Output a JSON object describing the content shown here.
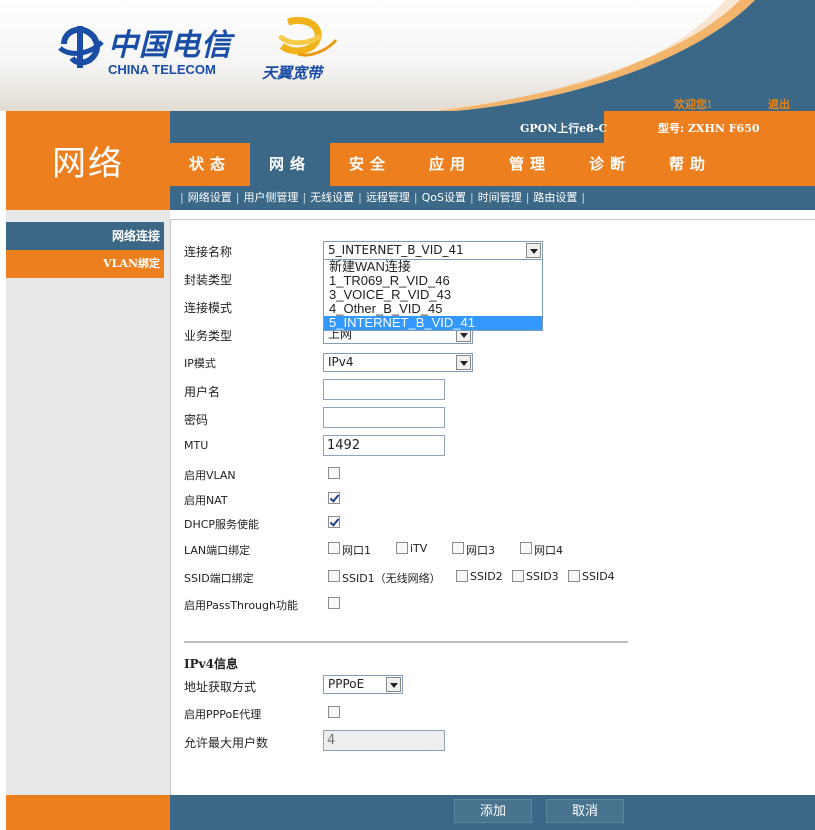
{
  "header": {
    "brand_cn": "中国电信",
    "brand_en": "CHINA TELECOM",
    "product_logo": "天翼宽带",
    "welcome": "欢迎您!",
    "logout": "退出",
    "gpon_label": "GPON上行e8-C",
    "model_label": "型号: ZXHN F650"
  },
  "section_title": "网络",
  "menu": {
    "items": [
      {
        "label": "状态",
        "active": false
      },
      {
        "label": "网络",
        "active": true
      },
      {
        "label": "安全",
        "active": false
      },
      {
        "label": "应用",
        "active": false
      },
      {
        "label": "管理",
        "active": false
      },
      {
        "label": "诊断",
        "active": false
      },
      {
        "label": "帮助",
        "active": false
      }
    ]
  },
  "submenu": {
    "items": [
      "网络设置",
      "用户侧管理",
      "无线设置",
      "远程管理",
      "QoS设置",
      "时间管理",
      "路由设置"
    ]
  },
  "sidebar": {
    "items": [
      "网络连接",
      "VLAN绑定"
    ]
  },
  "form": {
    "conn_name_label": "连接名称",
    "conn_name_value": "5_INTERNET_B_VID_41",
    "encap_label": "封装类型",
    "conn_mode_label": "连接模式",
    "service_label": "业务类型",
    "service_value": "上网",
    "ip_mode_label": "IP模式",
    "ip_mode_value": "IPv4",
    "username_label": "用户名",
    "username_value": "",
    "password_label": "密码",
    "password_value": "",
    "mtu_label": "MTU",
    "mtu_value": "1492",
    "vlan_label": "启用VLAN",
    "vlan_checked": false,
    "nat_label": "启用NAT",
    "nat_checked": true,
    "dhcp_label": "DHCP服务使能",
    "dhcp_checked": true,
    "lan_bind_label": "LAN端口绑定",
    "lan_ports": [
      {
        "label": "网口1",
        "checked": false
      },
      {
        "label": "iTV",
        "checked": false
      },
      {
        "label": "网口3",
        "checked": false
      },
      {
        "label": "网口4",
        "checked": false
      }
    ],
    "ssid_bind_label": "SSID端口绑定",
    "ssid_ports": [
      {
        "label": "SSID1（无线网络）",
        "checked": false
      },
      {
        "label": "SSID2",
        "checked": false
      },
      {
        "label": "SSID3",
        "checked": false
      },
      {
        "label": "SSID4",
        "checked": false
      }
    ],
    "passthrough_label": "启用PassThrough功能",
    "passthrough_checked": false
  },
  "dropdown_options": [
    {
      "label": "新建WAN连接",
      "selected": false
    },
    {
      "label": "1_TR069_R_VID_46",
      "selected": false
    },
    {
      "label": "3_VOICE_R_VID_43",
      "selected": false
    },
    {
      "label": "4_Other_B_VID_45",
      "selected": false
    },
    {
      "label": "5_INTERNET_B_VID_41",
      "selected": true
    }
  ],
  "ipv4": {
    "title": "IPv4信息",
    "addr_method_label": "地址获取方式",
    "addr_method_value": "PPPoE",
    "pppoe_proxy_label": "启用PPPoE代理",
    "pppoe_proxy_checked": false,
    "max_users_label": "允许最大用户数",
    "max_users_value": "4"
  },
  "footer": {
    "add_label": "添加",
    "cancel_label": "取消"
  },
  "colors": {
    "orange": "#ee7f1e",
    "blue": "#3b6887",
    "brand_blue": "#1a4da6"
  }
}
